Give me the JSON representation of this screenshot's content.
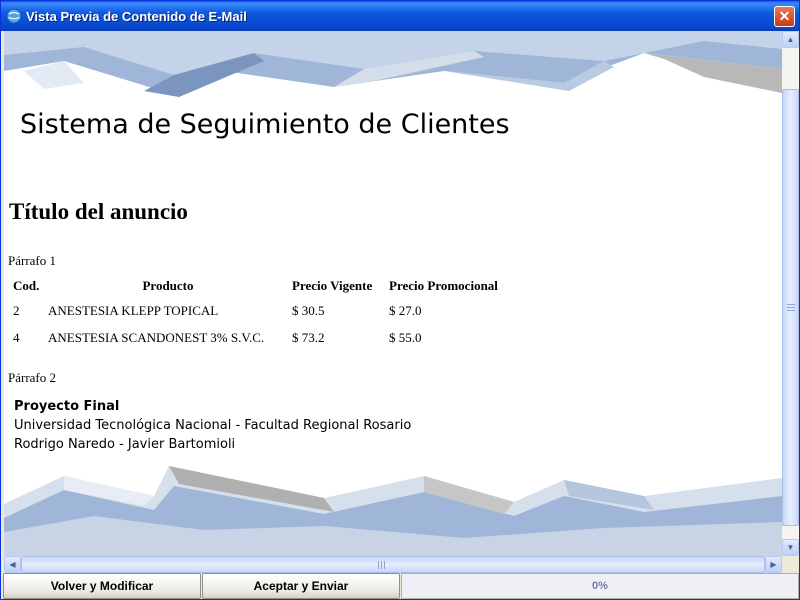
{
  "window": {
    "title": "Vista Previa de Contenido de E-Mail",
    "icon": "globe-icon",
    "close_label": "✕"
  },
  "email": {
    "header_title": "Sistema de Seguimiento de Clientes",
    "announcement_title": "Título del anuncio",
    "paragraph1": "Párrafo 1",
    "paragraph2": "Párrafo 2",
    "table": {
      "headers": [
        "Cod.",
        "Producto",
        "Precio Vigente",
        "Precio Promocional"
      ],
      "rows": [
        [
          "2",
          "ANESTESIA KLEPP TOPICAL",
          "$ 30.5",
          "$ 27.0"
        ],
        [
          "4",
          "ANESTESIA SCANDONEST 3% S.V.C.",
          "$ 73.2",
          "$ 55.0"
        ]
      ]
    },
    "signature": {
      "project": "Proyecto Final",
      "university": "Universidad Tecnológica Nacional - Facultad Regional Rosario",
      "authors": "Rodrigo Naredo - Javier Bartomioli"
    }
  },
  "buttons": {
    "back_label": "Volver y Modificar",
    "send_label": "Aceptar y Enviar"
  },
  "progress": {
    "value": 0,
    "label": "0%"
  },
  "colors": {
    "titlebar": "#0A5FE8",
    "accent_blue": "#9FB6D8",
    "gray_band": "#B8B8B8"
  }
}
